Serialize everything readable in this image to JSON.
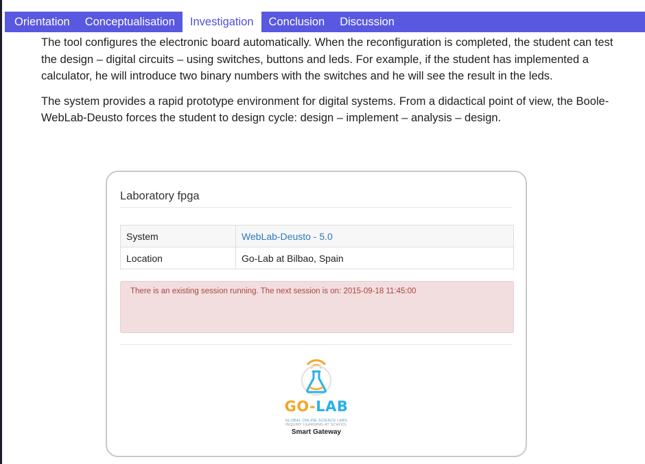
{
  "tabs": [
    "Orientation",
    "Conceptualisation",
    "Investigation",
    "Conclusion",
    "Discussion"
  ],
  "active_tab": "Investigation",
  "paragraphs": [
    "The tool configures the electronic board automatically. When the reconfiguration is completed, the student can test the design – digital circuits – using switches, buttons and leds. For example, if the student has implemented a calculator, he will introduce two binary numbers with the switches and he will see the result in the leds.",
    "The system provides a rapid prototype environment for digital systems. From a didactical point of view, the Boole-WebLab-Deusto forces the student to design cycle: design – implement – analysis – design."
  ],
  "lab": {
    "title": "Laboratory fpga",
    "rows": [
      {
        "key": "System",
        "value": "WebLab-Deusto - 5.0"
      },
      {
        "key": "Location",
        "value": "Go-Lab at Bilbao, Spain"
      }
    ],
    "alert": "There is an existing session running. The next session is on: 2015-09-18 11:45:00"
  },
  "logo": {
    "word_go": "GO-",
    "word_lab": "LAB",
    "tagline1": "GLOBAL ONLINE SCIENCE LABS",
    "tagline2": "INQUIRY LEARNING AT SCHOOL",
    "gateway": "Smart Gateway"
  },
  "colors": {
    "tab_bar": "#5858e0",
    "active_tab_text": "#5050d8",
    "link": "#2a7abf",
    "alert_bg": "#f2dede",
    "alert_text": "#a94442",
    "logo_orange": "#f5a623",
    "logo_blue": "#2ab1e6"
  }
}
